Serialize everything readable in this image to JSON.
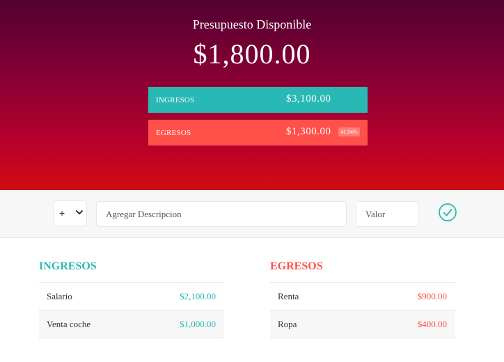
{
  "header": {
    "title": "Presupuesto Disponible",
    "budget": "$1,800.00",
    "income_label": "INGRESOS",
    "income_total": "$3,100.00",
    "expense_label": "EGRESOS",
    "expense_total": "$1,300.00",
    "expense_percentage": "41.94%"
  },
  "form": {
    "type_selected": "+",
    "description_placeholder": "Agregar Descripcion",
    "value_placeholder": "Valor",
    "submit_icon": "check-circle-icon"
  },
  "income": {
    "title": "INGRESOS",
    "items": [
      {
        "description": "Salario",
        "amount": "$2,100.00"
      },
      {
        "description": "Venta coche",
        "amount": "$1,000.00"
      }
    ]
  },
  "expenses": {
    "title": "EGRESOS",
    "items": [
      {
        "description": "Renta",
        "amount": "$900.00"
      },
      {
        "description": "Ropa",
        "amount": "$400.00"
      }
    ]
  },
  "colors": {
    "income": "#28b9b5",
    "expense": "#ff5049"
  }
}
